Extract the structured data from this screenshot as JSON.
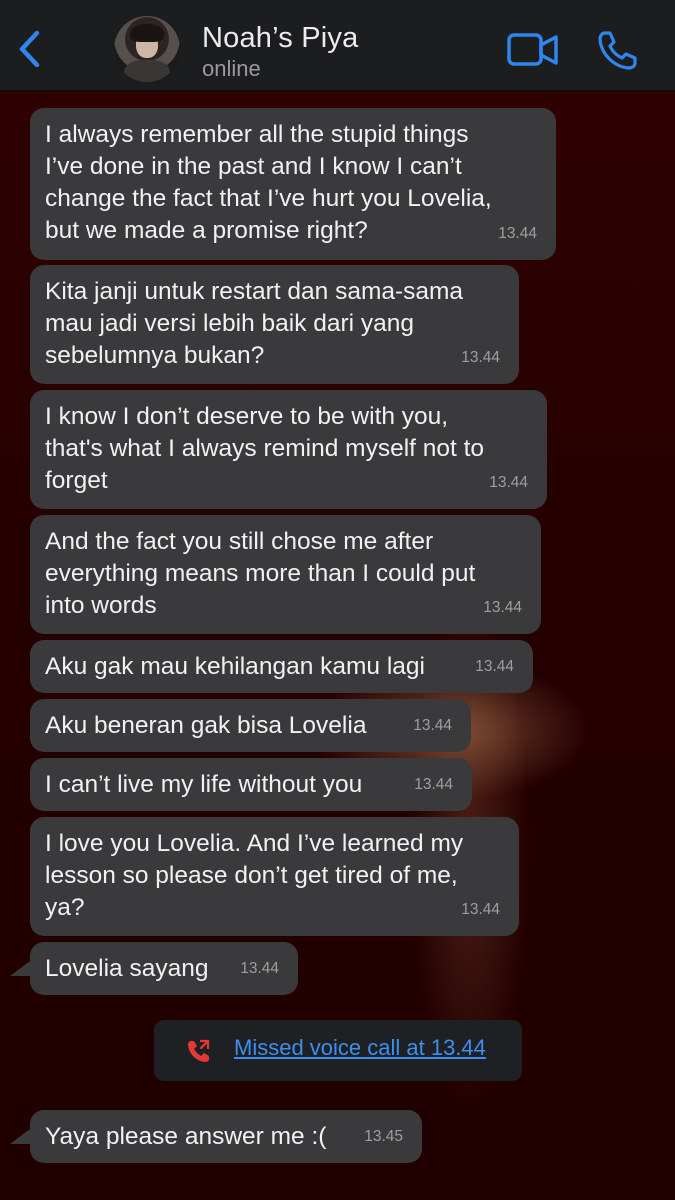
{
  "header": {
    "contact_name": "Noah’s Piya",
    "status": "online",
    "icons": {
      "back": "chevron-left-icon",
      "video": "video-camera-icon",
      "call": "phone-icon"
    },
    "accent_color": "#2f86ee"
  },
  "messages": [
    {
      "text": "I always remember all the stupid things\nI’ve done in the past and I know I can’t\nchange the fact that I’ve hurt you Lovelia,\nbut we made a promise right?",
      "time": "13.44"
    },
    {
      "text": "Kita janji untuk restart dan sama-sama\nmau jadi versi lebih baik dari yang\nsebelumnya bukan?",
      "time": "13.44"
    },
    {
      "text": "I know I don’t deserve to be with you,\nthat's what I always remind myself not to\nforget",
      "time": "13.44"
    },
    {
      "text": "And the fact you still chose me after\neverything means more than I could put\ninto words",
      "time": "13.44"
    },
    {
      "text": "Aku gak mau kehilangan kamu lagi",
      "time": "13.44"
    },
    {
      "text": "Aku beneran gak bisa Lovelia",
      "time": "13.44"
    },
    {
      "text": "I can’t live my life without you",
      "time": "13.44"
    },
    {
      "text": "I love you Lovelia. And I’ve learned my\nlesson so please don’t get tired of me,\nya?",
      "time": "13.44"
    },
    {
      "text": "Lovelia sayang",
      "time": "13.44"
    },
    {
      "text": "Yaya please answer me :(",
      "time": "13.45"
    }
  ],
  "missed_call": {
    "text": "Missed voice call at 13.44",
    "icon": "missed-call-icon",
    "color": "#e53935"
  }
}
